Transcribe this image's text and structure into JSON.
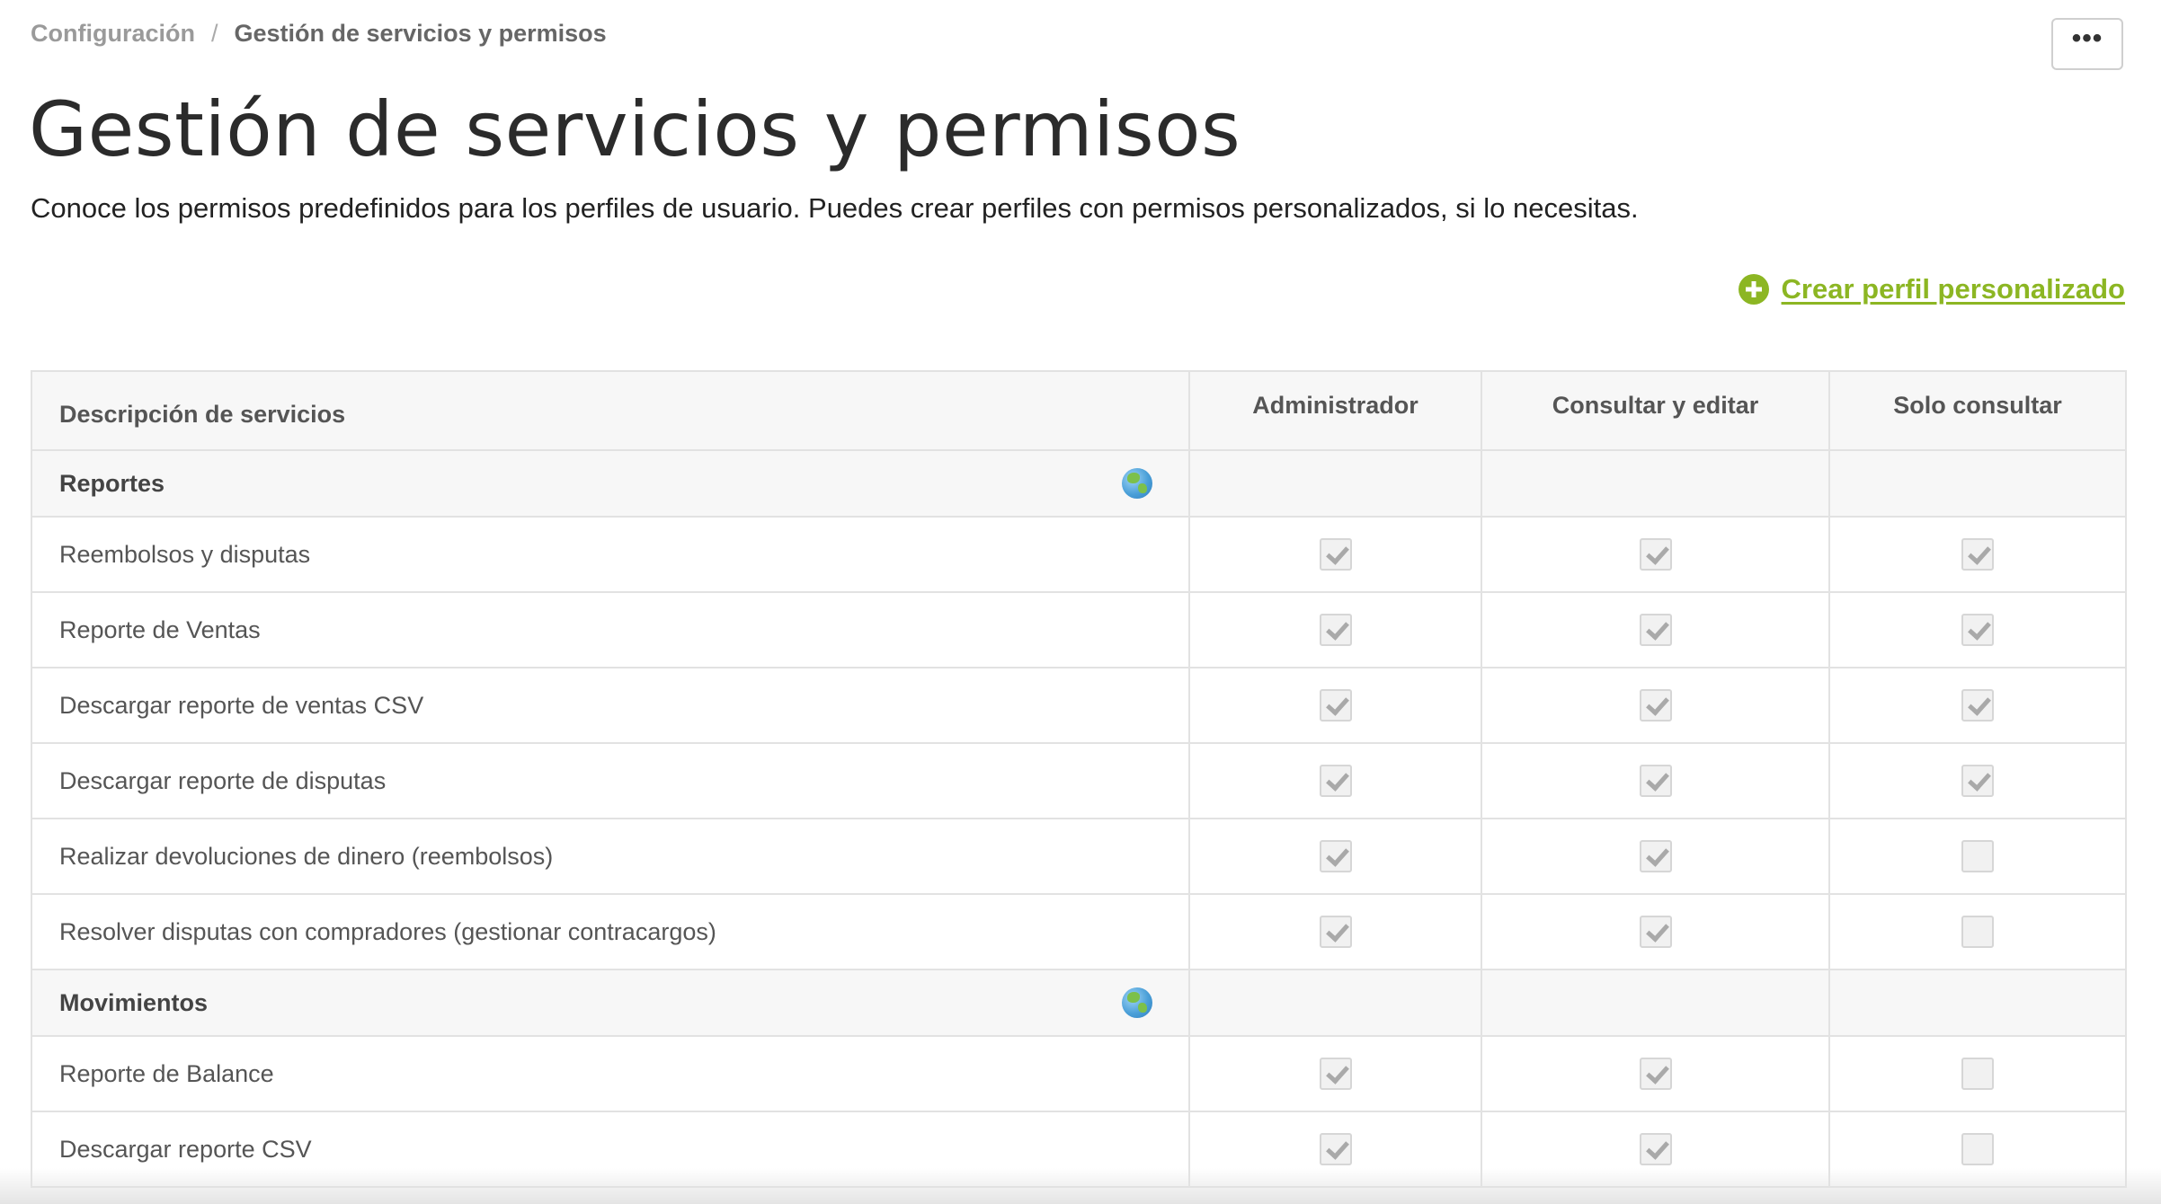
{
  "breadcrumb": {
    "parent": "Configuración",
    "separator": "/",
    "current": "Gestión de servicios y permisos"
  },
  "more_button": {
    "label": "•••"
  },
  "title": "Gestión de servicios y permisos",
  "subtitle": "Conoce los permisos predefinidos para los perfiles de usuario. Puedes crear perfiles con permisos personalizados, si lo necesitas.",
  "create_link": {
    "label": "Crear perfil personalizado",
    "icon": "plus-circle-icon",
    "color": "#8cb623"
  },
  "table": {
    "headers": [
      "Descripción de servicios",
      "Administrador",
      "Consultar y editar",
      "Solo consultar"
    ],
    "sections": [
      {
        "name": "Reportes",
        "icon": "globe-icon",
        "items": [
          {
            "label": "Reembolsos y disputas",
            "perms": [
              true,
              true,
              true
            ]
          },
          {
            "label": "Reporte de Ventas",
            "perms": [
              true,
              true,
              true
            ]
          },
          {
            "label": "Descargar reporte de ventas CSV",
            "perms": [
              true,
              true,
              true
            ]
          },
          {
            "label": "Descargar reporte de disputas",
            "perms": [
              true,
              true,
              true
            ]
          },
          {
            "label": "Realizar devoluciones de dinero (reembolsos)",
            "perms": [
              true,
              true,
              false
            ]
          },
          {
            "label": "Resolver disputas con compradores (gestionar contracargos)",
            "perms": [
              true,
              true,
              false
            ]
          }
        ]
      },
      {
        "name": "Movimientos",
        "icon": "globe-icon",
        "items": [
          {
            "label": "Reporte de Balance",
            "perms": [
              true,
              true,
              false
            ]
          },
          {
            "label": "Descargar reporte CSV",
            "perms": [
              true,
              true,
              false
            ]
          }
        ]
      }
    ]
  }
}
